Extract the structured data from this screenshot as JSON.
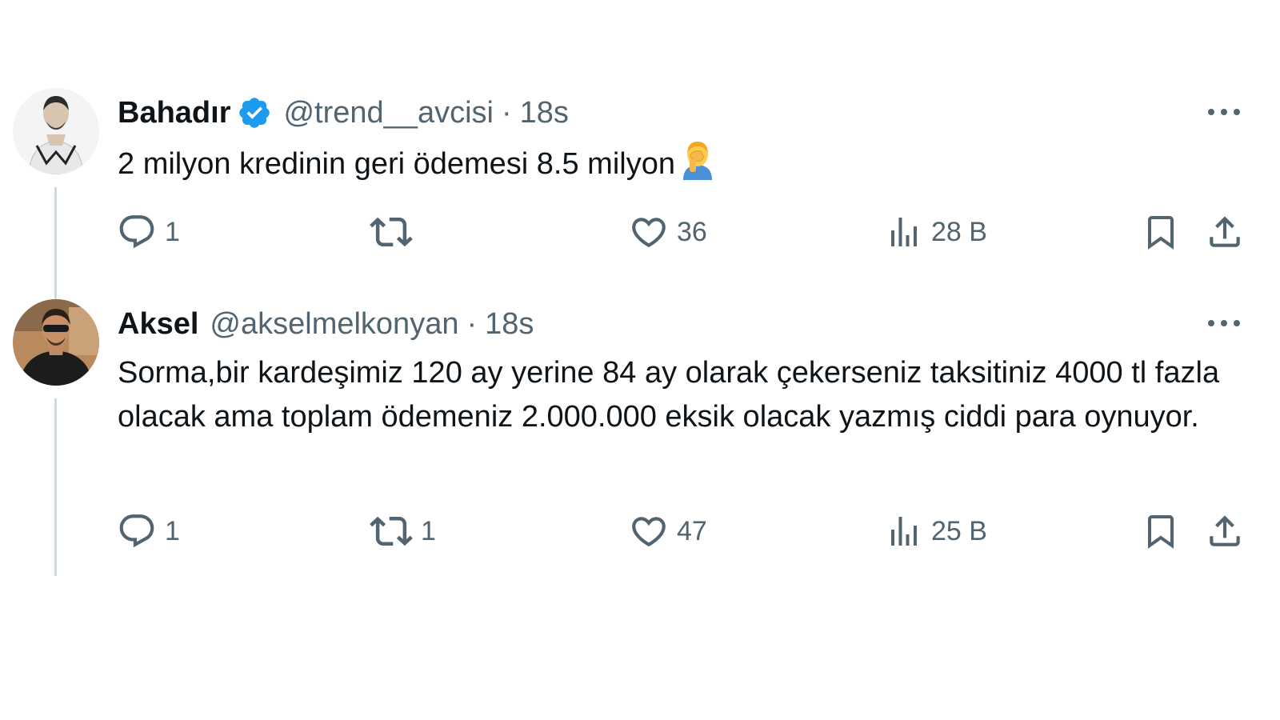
{
  "tweets": [
    {
      "author": {
        "name": "Bahadır",
        "verified": true,
        "handle": "@trend__avcisi"
      },
      "separator": "·",
      "time": "18s",
      "text": "2 milyon kredinin geri ödemesi 8.5 milyon",
      "emoji": "facepalm-emoji",
      "actions": {
        "reply_count": "1",
        "retweet_count": "",
        "like_count": "36",
        "view_count": "28 B"
      }
    },
    {
      "author": {
        "name": "Aksel",
        "verified": false,
        "handle": "@akselmelkonyan"
      },
      "separator": "·",
      "time": "18s",
      "text": "Sorma,bir kardeşimiz 120 ay yerine 84 ay olarak çekerseniz taksitiniz 4000 tl fazla olacak ama toplam ödemeniz 2.000.000 eksik olacak yazmış ciddi para oynuyor.",
      "actions": {
        "reply_count": "1",
        "retweet_count": "1",
        "like_count": "47",
        "view_count": "25 B"
      }
    }
  ],
  "colors": {
    "text_primary": "#0f1419",
    "text_secondary": "#536471",
    "verified_blue": "#1d9bf0",
    "thread_line": "#cfd9de"
  },
  "icons": [
    "more-icon",
    "reply-icon",
    "retweet-icon",
    "like-icon",
    "views-icon",
    "bookmark-icon",
    "share-icon",
    "verified-badge-icon"
  ]
}
